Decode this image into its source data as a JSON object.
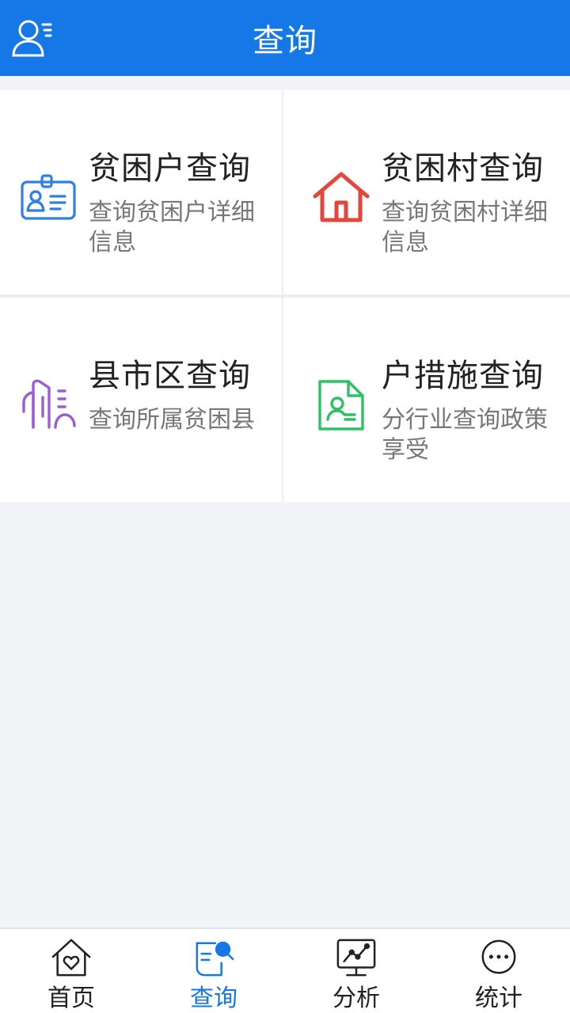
{
  "header": {
    "title": "查询",
    "profile_icon": "user-list-icon"
  },
  "cards": [
    {
      "title": "贫困户查询",
      "desc": "查询贫困户详细信息",
      "icon": "id-card-icon",
      "color": "#2f7fe8"
    },
    {
      "title": "贫困村查询",
      "desc": "查询贫困村详细信息",
      "icon": "house-icon",
      "color": "#e5463c"
    },
    {
      "title": "县市区查询",
      "desc": "查询所属贫困县",
      "icon": "buildings-icon",
      "color": "#9b5cd6"
    },
    {
      "title": "户措施查询",
      "desc": "分行业查询政策享受",
      "icon": "document-person-icon",
      "color": "#2fbf64"
    }
  ],
  "nav": [
    {
      "label": "首页",
      "icon": "home-heart-icon",
      "active": false
    },
    {
      "label": "查询",
      "icon": "search-doc-icon",
      "active": true
    },
    {
      "label": "分析",
      "icon": "chart-monitor-icon",
      "active": false
    },
    {
      "label": "统计",
      "icon": "more-dots-icon",
      "active": false
    }
  ],
  "colors": {
    "primary": "#1677e6",
    "background": "#f3f4f7"
  }
}
